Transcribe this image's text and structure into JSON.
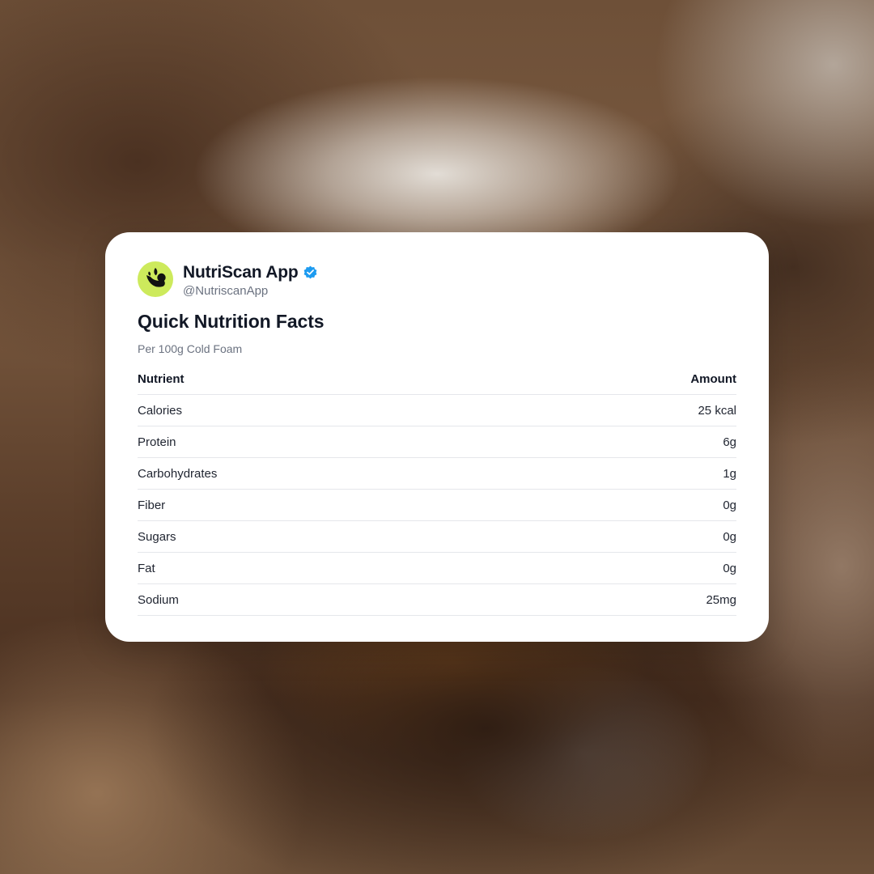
{
  "profile": {
    "name": "NutriScan App",
    "handle": "@NutriscanApp",
    "avatar_icon": "leaf-logo-icon",
    "avatar_color": "#cdea5c",
    "verified_icon": "verified-badge-icon",
    "verified_color": "#1d9bf0"
  },
  "card": {
    "title": "Quick Nutrition Facts",
    "subtitle": "Per 100g Cold Foam"
  },
  "table": {
    "headers": {
      "nutrient": "Nutrient",
      "amount": "Amount"
    },
    "rows": [
      {
        "nutrient": "Calories",
        "amount": "25 kcal"
      },
      {
        "nutrient": "Protein",
        "amount": "6g"
      },
      {
        "nutrient": "Carbohydrates",
        "amount": "1g"
      },
      {
        "nutrient": "Fiber",
        "amount": "0g"
      },
      {
        "nutrient": "Sugars",
        "amount": "0g"
      },
      {
        "nutrient": "Fat",
        "amount": "0g"
      },
      {
        "nutrient": "Sodium",
        "amount": "25mg"
      }
    ]
  }
}
